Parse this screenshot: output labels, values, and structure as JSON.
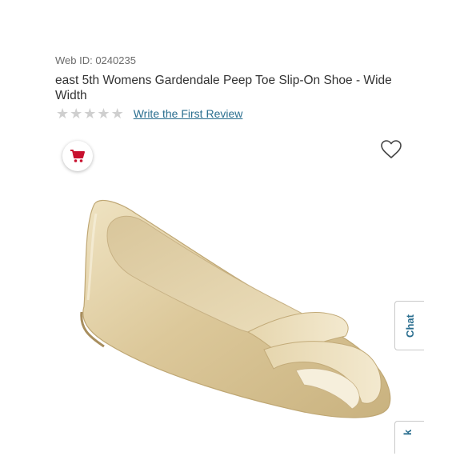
{
  "product": {
    "web_id": "Web ID: 0240235",
    "title": "east 5th Womens Gardendale Peep Toe Slip-On Shoe - Wide Width",
    "rating": 0,
    "rating_max": 5,
    "review_link": "Write the First Review"
  },
  "actions": {
    "cart_icon": "cart-icon",
    "favorite_icon": "heart-icon"
  },
  "side_tabs": {
    "chat_label": "Chat",
    "feedback_label": "k"
  },
  "colors": {
    "link": "#2a6e8f",
    "cart": "#c8102e",
    "star_empty": "#cfcfcf"
  }
}
